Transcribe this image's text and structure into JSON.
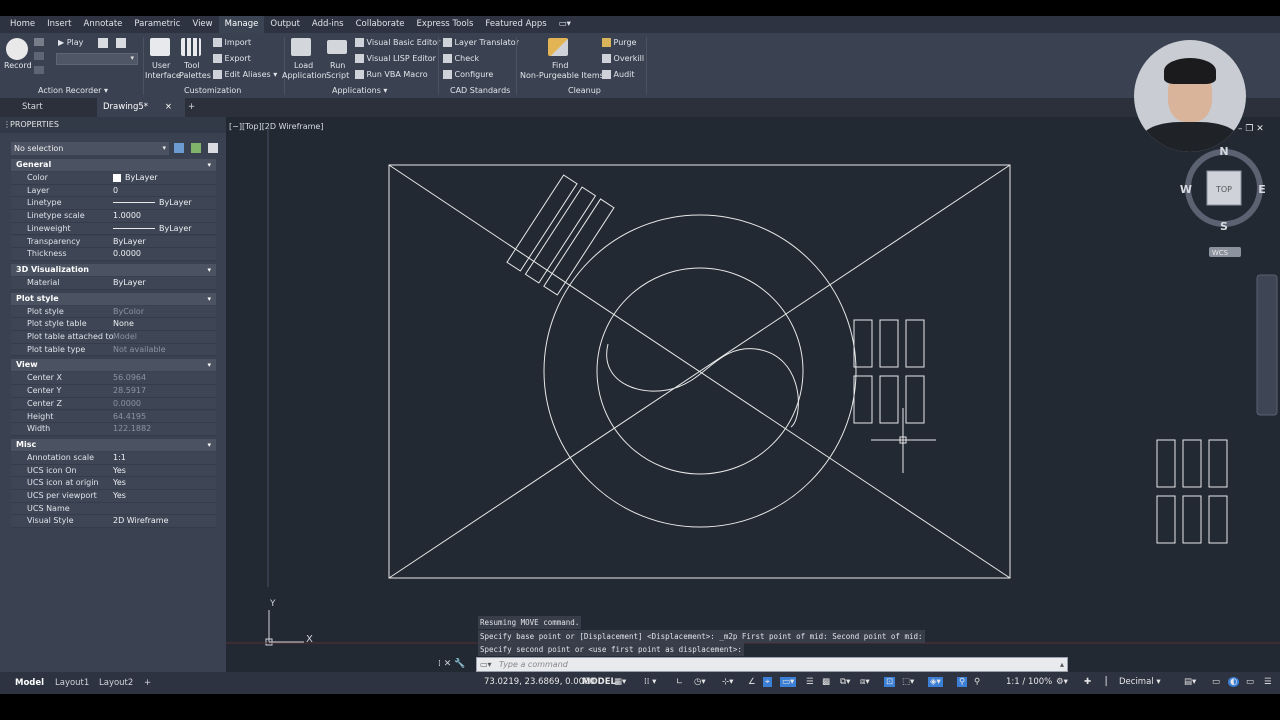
{
  "menu": {
    "tabs": [
      "Home",
      "Insert",
      "Annotate",
      "Parametric",
      "View",
      "Manage",
      "Output",
      "Add-ins",
      "Collaborate",
      "Express Tools",
      "Featured Apps"
    ],
    "active": "Manage"
  },
  "ribbon": {
    "record": "Record",
    "play": "Play",
    "action_recorder": "Action Recorder",
    "user_interface": [
      "User",
      "Interface"
    ],
    "tool_palettes": [
      "Tool",
      "Palettes"
    ],
    "import": "Import",
    "export": "Export",
    "edit_aliases": "Edit Aliases",
    "customization": "Customization",
    "load_application": [
      "Load",
      "Application"
    ],
    "run_script": [
      "Run",
      "Script"
    ],
    "vba_editor": "Visual Basic Editor",
    "lisp_editor": "Visual LISP Editor",
    "run_vba": "Run VBA Macro",
    "applications": "Applications",
    "layer_translator": "Layer Translator",
    "check": "Check",
    "configure": "Configure",
    "cad_standards": "CAD Standards",
    "find": "Find",
    "non_purgeable": "Non-Purgeable Items",
    "purge": "Purge",
    "overkill": "Overkill",
    "audit": "Audit",
    "cleanup": "Cleanup"
  },
  "doctabs": {
    "start": "Start",
    "drawing": "Drawing5*",
    "close": "×",
    "add": "+"
  },
  "properties": {
    "title": "PROPERTIES",
    "selection": "No selection",
    "sections": [
      {
        "name": "General",
        "rows": [
          {
            "k": "Color",
            "v": "ByLayer"
          },
          {
            "k": "Layer",
            "v": "0"
          },
          {
            "k": "Linetype",
            "v": "ByLayer"
          },
          {
            "k": "Linetype scale",
            "v": "1.0000"
          },
          {
            "k": "Lineweight",
            "v": "ByLayer"
          },
          {
            "k": "Transparency",
            "v": "ByLayer"
          },
          {
            "k": "Thickness",
            "v": "0.0000"
          }
        ]
      },
      {
        "name": "3D Visualization",
        "rows": [
          {
            "k": "Material",
            "v": "ByLayer"
          }
        ]
      },
      {
        "name": "Plot style",
        "rows": [
          {
            "k": "Plot style",
            "v": "ByColor",
            "dim": true
          },
          {
            "k": "Plot style table",
            "v": "None"
          },
          {
            "k": "Plot table attached to",
            "v": "Model",
            "dim": true
          },
          {
            "k": "Plot table type",
            "v": "Not available",
            "dim": true
          }
        ]
      },
      {
        "name": "View",
        "rows": [
          {
            "k": "Center X",
            "v": "56.0964",
            "dim": true
          },
          {
            "k": "Center Y",
            "v": "28.5917",
            "dim": true
          },
          {
            "k": "Center Z",
            "v": "0.0000",
            "dim": true
          },
          {
            "k": "Height",
            "v": "64.4195",
            "dim": true
          },
          {
            "k": "Width",
            "v": "122.1882",
            "dim": true
          }
        ]
      },
      {
        "name": "Misc",
        "rows": [
          {
            "k": "Annotation scale",
            "v": "1:1"
          },
          {
            "k": "UCS icon On",
            "v": "Yes"
          },
          {
            "k": "UCS icon at origin",
            "v": "Yes"
          },
          {
            "k": "UCS per viewport",
            "v": "Yes"
          },
          {
            "k": "UCS Name",
            "v": ""
          },
          {
            "k": "Visual Style",
            "v": "2D Wireframe"
          }
        ]
      }
    ]
  },
  "viewport": {
    "label": "[−][Top][2D Wireframe]",
    "compass": {
      "n": "N",
      "s": "S",
      "e": "E",
      "w": "W",
      "top": "TOP",
      "wcs": "WCS"
    },
    "ucs": {
      "x": "X",
      "y": "Y"
    }
  },
  "command": {
    "history": [
      "Resuming MOVE command.",
      "Specify base point or [Displacement] <Displacement>: _m2p First point of mid: Second point of mid:",
      "Specify second point or <use first point as displacement>:"
    ],
    "placeholder": "Type a command"
  },
  "status": {
    "layouts": [
      "Model",
      "Layout1",
      "Layout2"
    ],
    "add": "+",
    "coords": "73.0219, 23.6869, 0.0000",
    "model": "MODEL",
    "scale": "1:1 / 100%",
    "units": "Decimal"
  },
  "colors": {
    "canvas": "#222933",
    "panel": "#3a4150",
    "accent": "#3c7fd6",
    "lines": "#e8e8e8"
  }
}
